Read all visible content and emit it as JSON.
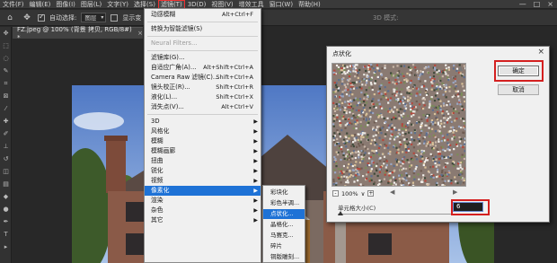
{
  "menubar": {
    "items": [
      "文件(F)",
      "编辑(E)",
      "图像(I)",
      "图层(L)",
      "文字(Y)",
      "选择(S)",
      "滤镜(T)",
      "3D(D)",
      "视图(V)",
      "增效工具",
      "窗口(W)",
      "帮助(H)"
    ],
    "active_index": 6
  },
  "options": {
    "auto_select_label": "自动选择:",
    "auto_select_value": "图层",
    "show_transform_label": "显示变",
    "mode_3d_label": "3D 模式:"
  },
  "document": {
    "tab_label": "FZ.jpeg @ 100% (背景 拷贝, RGB/8#) *",
    "close_glyph": "×"
  },
  "filter_menu": {
    "items": [
      {
        "label": "动感模糊",
        "shortcut": "Alt+Ctrl+F"
      },
      {
        "sep": true
      },
      {
        "label": "转换为智能滤镜(S)"
      },
      {
        "sep": true
      },
      {
        "label": "Neural Filters...",
        "disabled": true
      },
      {
        "sep": true
      },
      {
        "label": "滤镜库(G)..."
      },
      {
        "label": "自适应广角(A)...",
        "shortcut": "Alt+Shift+Ctrl+A"
      },
      {
        "label": "Camera Raw 滤镜(C)...",
        "shortcut": "Shift+Ctrl+A"
      },
      {
        "label": "镜头校正(R)...",
        "shortcut": "Shift+Ctrl+R"
      },
      {
        "label": "液化(L)...",
        "shortcut": "Shift+Ctrl+X"
      },
      {
        "label": "消失点(V)...",
        "shortcut": "Alt+Ctrl+V"
      },
      {
        "sep": true
      },
      {
        "label": "3D",
        "submenu": true
      },
      {
        "label": "风格化",
        "submenu": true
      },
      {
        "label": "模糊",
        "submenu": true
      },
      {
        "label": "模糊画廊",
        "submenu": true
      },
      {
        "label": "扭曲",
        "submenu": true
      },
      {
        "label": "锐化",
        "submenu": true
      },
      {
        "label": "视频",
        "submenu": true
      },
      {
        "label": "像素化",
        "submenu": true,
        "highlighted": true
      },
      {
        "label": "渲染",
        "submenu": true
      },
      {
        "label": "杂色",
        "submenu": true
      },
      {
        "label": "其它",
        "submenu": true
      }
    ]
  },
  "pixelate_submenu": {
    "items": [
      "彩块化",
      "彩色半调...",
      "点状化...",
      "晶格化...",
      "马赛克...",
      "碎片",
      "铜版雕刻..."
    ],
    "highlighted_index": 2
  },
  "dialog": {
    "title": "点状化",
    "close_glyph": "×",
    "ok_label": "确定",
    "cancel_label": "取消",
    "zoom_minus": "-",
    "zoom_plus": "+",
    "zoom_value": "100%",
    "zoom_chevron": "∨",
    "param_label": "单元格大小(C)",
    "cell_size": "6"
  },
  "icons": {
    "move": "✥",
    "window_min": "—",
    "window_max": "□",
    "window_close": "×"
  },
  "colors": {
    "highlight": "#1e72d6",
    "annotation_red": "#d42020"
  }
}
